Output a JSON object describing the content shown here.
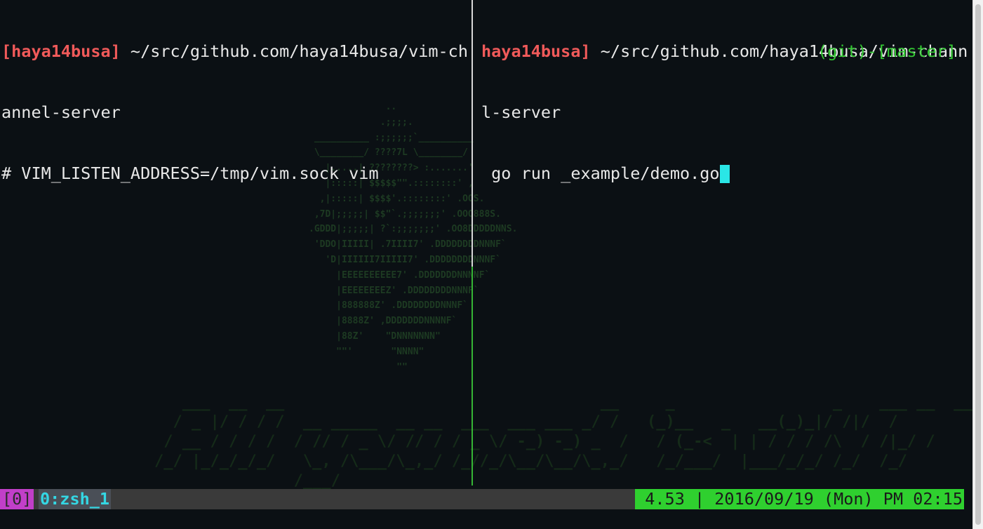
{
  "left_pane": {
    "prompt_user": "[haya14busa]",
    "prompt_path_line1": " ~/src/github.com/haya14busa/vim-ch",
    "prompt_path_line2": "annel-server",
    "command": "# VIM_LISTEN_ADDRESS=/tmp/vim.sock vim"
  },
  "right_pane": {
    "prompt_user": "haya14busa]",
    "prompt_path_line1": " ~/src/github.com/haya14busa/vim-chann",
    "prompt_path_line2": "l-server",
    "command": " go run _example/demo.go",
    "git_status": "(git)-[master]"
  },
  "background_art": {
    "logo": "              ..\n             .;;;;.\n __________ :;;;;;;`__________\n \\________/ ????7L \\________/\n   |.....| ????????> :.......'\n   |:::::| $$$$$\"\".::::::::' ,\n  ,|:::::| $$$$'.::::::::' .OOS.\n ,7D|;;;;;| $$\"`.;;;;;;;' .OOO888S.\n.GDDD|;;;;;| ?`:;;;;;;;' .OO8DDDDDNNS.\n 'DDO|IIIII| .7IIII7' .DDDDDDDDNNNF`\n   'D|IIIIII7IIIII7' .DDDDDDDDNNNF`\n     |EEEEEEEEEE7' .DDDDDDDNNNNF`\n     |EEEEEEEEZ' .DDDDDDDDNNNF`\n     |888888Z' .DDDDDDDDNNNF`\n     |8888Z' ,DDDDDDDNNNNF`\n     |88Z'    \"DNNNNNNN\"\n     \"\"'       \"NNNN\"\n                \"\"",
    "slogan": "   ___  __  __                                  __     _                 _    ___ __  ___\n  / _ |/ / / /  __ _____  __ __  ___  ___ ___ _/ /   (_)__   _   __(_)_|/ /|/  /\n / __ / / / /  / // / _ \\/ // / / _ \\/ -_) -_) _  /   / (_-<  | | / / / /\\  / /|_/ /\n/_/ |_/_/_/_/   \\_, /\\___/\\_,_/ /_//_/\\__/\\__/\\_,_/   /_/___/  |___/_/_/ /_/  /_/\n               /___/"
  },
  "statusbar": {
    "session": "[0]",
    "window": "0:zsh_1",
    "right": "4.53 | 2016/09/19 (Mon) PM 02:15"
  },
  "colors": {
    "prompt_user": "#f05a5a",
    "git": "#34c934",
    "cursor": "#2ae6e6",
    "session_bg": "#c13fc8",
    "status_right_bg": "#2fd02f",
    "window_tab_fg": "#34d7e4"
  }
}
